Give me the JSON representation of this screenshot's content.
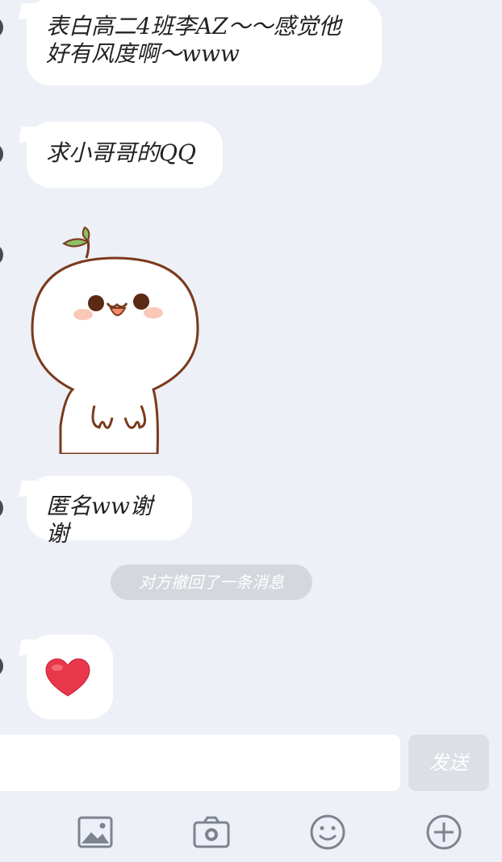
{
  "messages": [
    {
      "text": "表白高二4班李AZ～～感觉他好有风度啊～www"
    },
    {
      "text": "求小哥哥的QQ"
    },
    {
      "type": "sticker",
      "sticker": "cute-bun-character-sticker"
    },
    {
      "text": "匿名ww谢谢"
    },
    {
      "type": "emoji",
      "emoji": "❤"
    }
  ],
  "system_notice": "对方撤回了一条消息",
  "composer": {
    "input_value": "",
    "send_label": "发送"
  },
  "toolbar": {
    "icons": [
      "image-icon",
      "camera-icon",
      "emoji-icon",
      "plus-icon"
    ]
  },
  "colors": {
    "background": "#edf0f6",
    "bubble": "#ffffff",
    "heart": "#e8364a",
    "sticker_outline": "#7a3a1c",
    "leaf": "#8cc06a"
  }
}
